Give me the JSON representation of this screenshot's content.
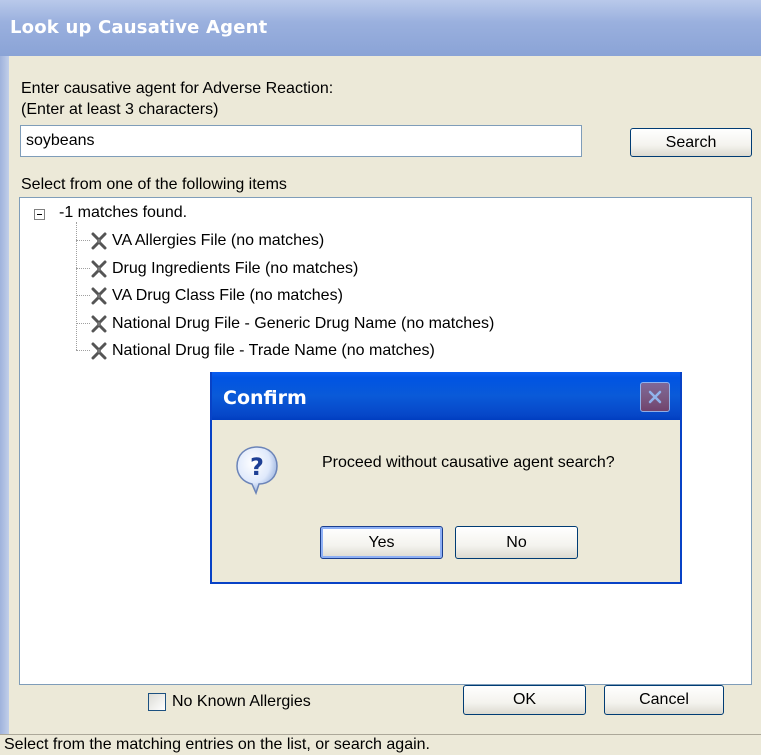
{
  "window": {
    "title": "Look up Causative Agent"
  },
  "prompt": {
    "line1": "Enter causative agent for Adverse Reaction:",
    "line2": "(Enter at least 3 characters)"
  },
  "search": {
    "value": "soybeans",
    "button_label": "Search"
  },
  "results": {
    "label": "Select from one of the following items",
    "root": "-1 matches found.",
    "items": [
      "VA Allergies File  (no matches)",
      "Drug Ingredients File  (no matches)",
      "VA Drug Class File  (no matches)",
      "National Drug File - Generic Drug Name  (no matches)",
      "National Drug file - Trade Name  (no matches)"
    ]
  },
  "footer": {
    "no_known_allergies_label": "No Known Allergies",
    "no_known_allergies_checked": false,
    "ok_label": "OK",
    "cancel_label": "Cancel"
  },
  "status_text": "Select from the matching entries on the list, or search again.",
  "dialog": {
    "title": "Confirm",
    "icon": "question-icon",
    "message": "Proceed without causative agent search?",
    "yes_label": "Yes",
    "no_label": "No"
  },
  "colors": {
    "main_titlebar": "#9ab0de",
    "dialog_titlebar": "#0054e3",
    "window_bg": "#ece9d8"
  }
}
